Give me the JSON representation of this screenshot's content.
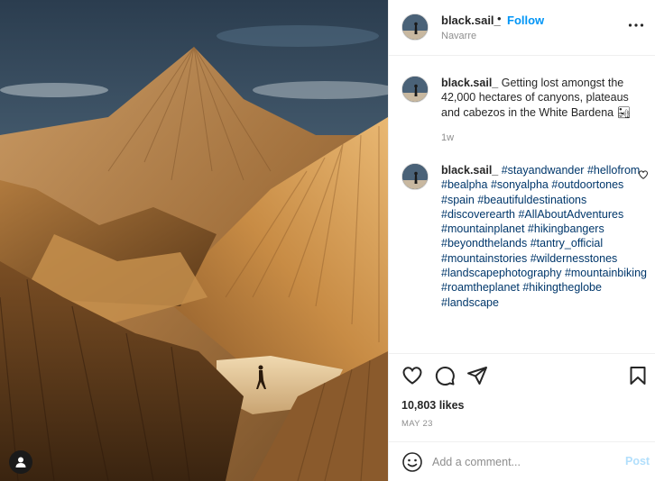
{
  "post": {
    "image_alt": "Badlands canyons with a hiker",
    "colors": {
      "accent": "#0095f6",
      "text": "#262626",
      "muted": "#8e8e8e",
      "hashtag": "#00376b",
      "post_disabled": "#b2dffc"
    }
  },
  "header": {
    "username": "black.sail_",
    "separator": "•",
    "follow_label": "Follow",
    "location": "Navarre",
    "more_icon": "more-horizontal-icon"
  },
  "caption": {
    "username": "black.sail_",
    "text": "Getting lost amongst the 42,000 hectares of canyons, plateaus and cabezos in the White Bardena 🏜",
    "time": "1w"
  },
  "comment": {
    "username": "black.sail_",
    "hashtags": [
      "#stayandwander",
      "#hellofrom",
      "#bealpha",
      "#sonyalpha",
      "#outdoortones",
      "#spain",
      "#beautifuldestinations",
      "#discoverearth",
      "#AllAboutAdventures",
      "#mountainplanet",
      "#hikingbangers",
      "#beyondthelands",
      "#tantry_official",
      "#mountainstories",
      "#wildernesstones",
      "#landscapephotography",
      "#mountainbiking",
      "#roamtheplanet",
      "#hikingtheglobe",
      "#landscape"
    ]
  },
  "actions": {
    "icons": [
      "heart-icon",
      "comment-icon",
      "share-icon",
      "bookmark-icon"
    ],
    "likes": "10,803 likes",
    "date": "MAY 23"
  },
  "add_comment": {
    "placeholder": "Add a comment...",
    "post_label": "Post"
  }
}
